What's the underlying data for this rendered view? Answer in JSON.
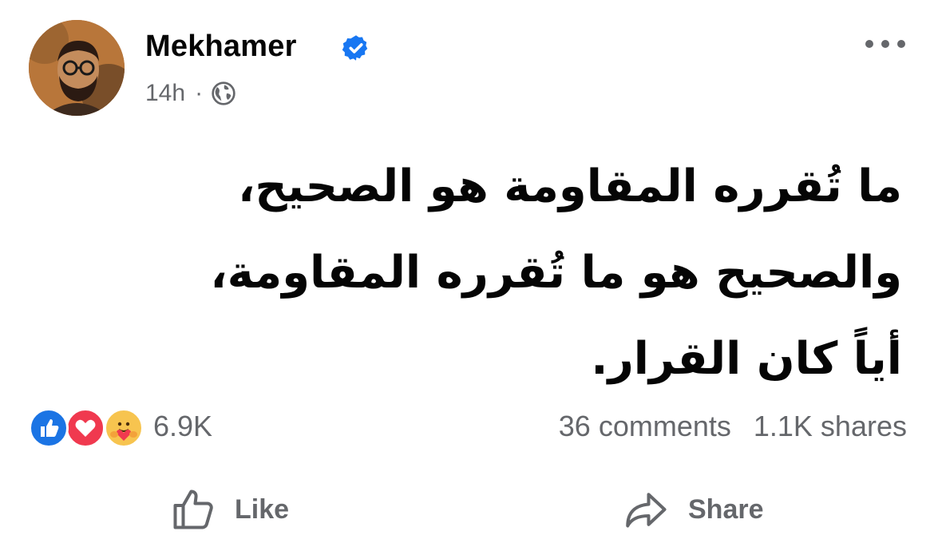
{
  "post": {
    "author": {
      "name": "Mekhamer",
      "verified": true
    },
    "meta": {
      "time": "14h",
      "separator": "·",
      "audience_icon": "globe-icon"
    },
    "text_lines": [
      "ما تُقرره المقاومة هو الصحيح،",
      "والصحيح هو ما تُقرره المقاومة،",
      "أياً كان القرار."
    ],
    "reactions": {
      "types": [
        "like",
        "love",
        "care"
      ],
      "count": "6.9K"
    },
    "comments_count": "36 comments",
    "shares_count": "1.1K shares",
    "actions": {
      "like_label": "Like",
      "share_label": "Share"
    },
    "colors": {
      "verified_blue": "#1877f2",
      "secondary_text": "#65676b",
      "like_blue": "#1b74e4",
      "love_red": "#f0394f",
      "care_yellow": "#f7c44f"
    }
  }
}
